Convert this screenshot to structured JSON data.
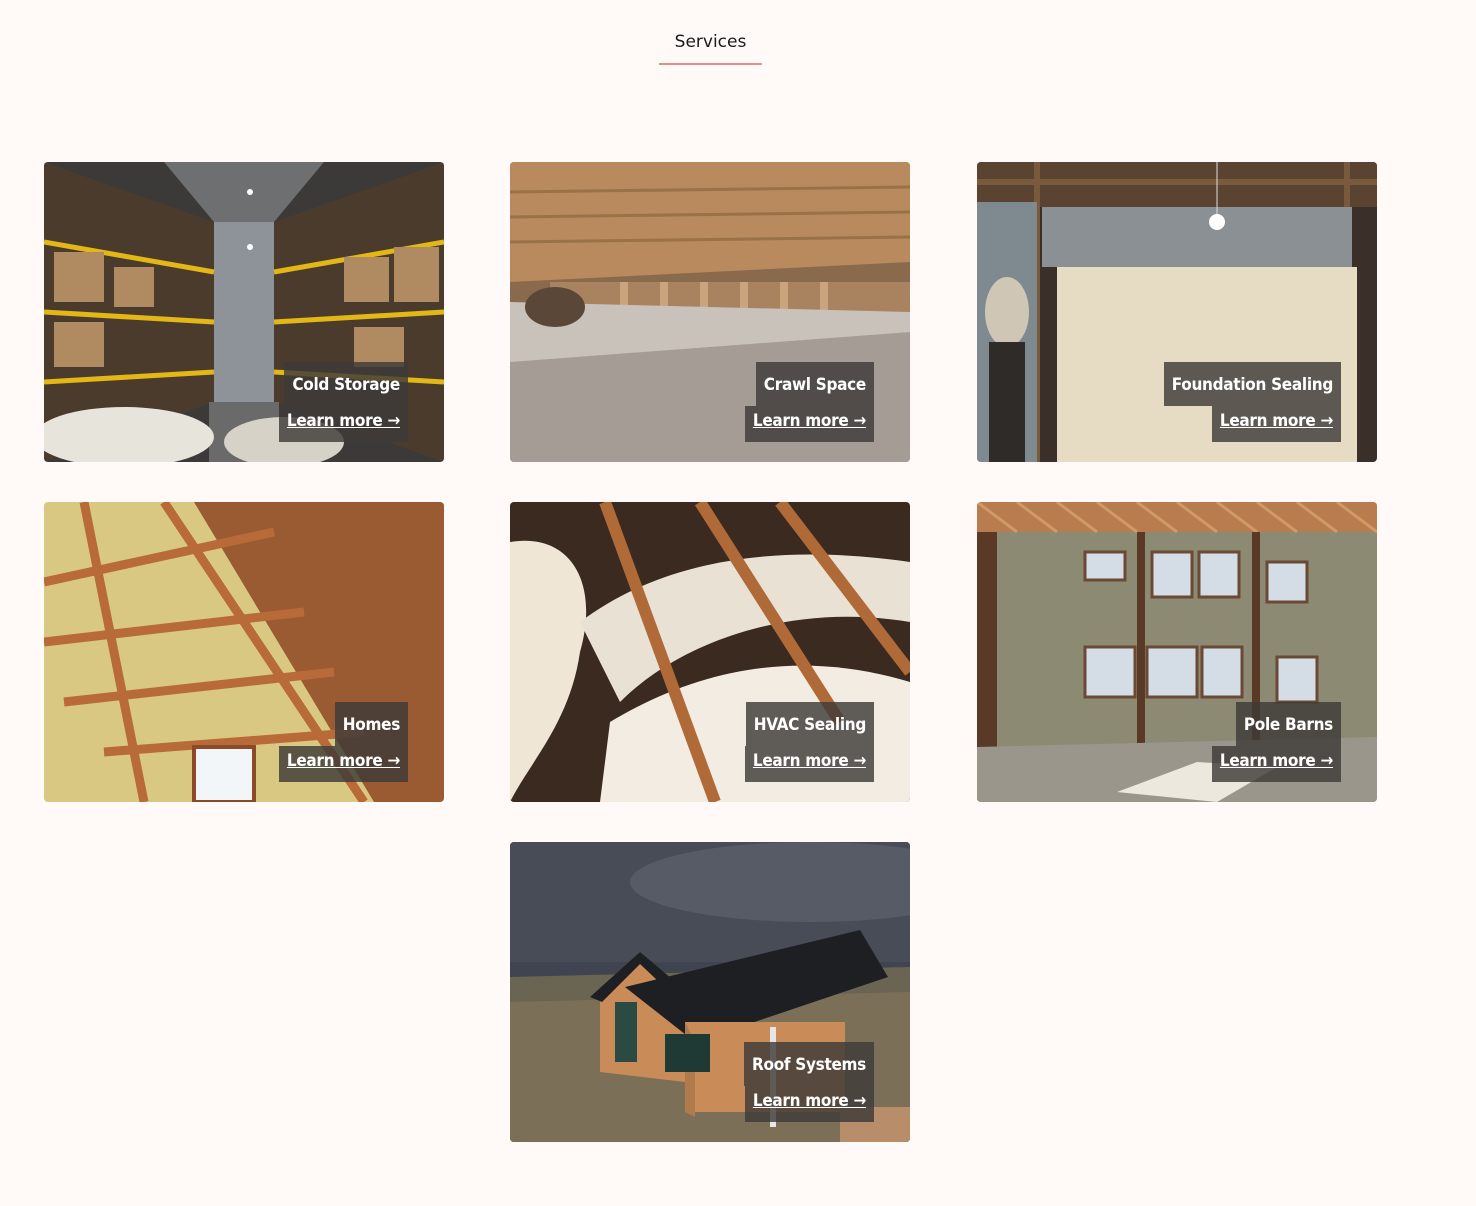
{
  "tab": {
    "label": "Services"
  },
  "cards": [
    {
      "title": "Cold Storage",
      "link": "Learn more →"
    },
    {
      "title": "Crawl Space",
      "link": "Learn more →"
    },
    {
      "title": "Foundation Sealing",
      "link": "Learn more →"
    },
    {
      "title": "Homes",
      "link": "Learn more →"
    },
    {
      "title": "HVAC Sealing",
      "link": "Learn more →"
    },
    {
      "title": "Pole Barns",
      "link": "Learn more →"
    },
    {
      "title": "Roof Systems",
      "link": "Learn more →"
    }
  ],
  "colors": {
    "background": "#fffaf7",
    "tab_underline": "#e88b8b",
    "caption_bg": "#3e3a38"
  }
}
